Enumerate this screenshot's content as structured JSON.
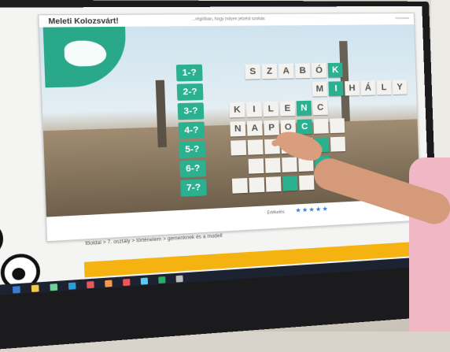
{
  "card": {
    "title": "Meleti Kolozsvárt!",
    "subtitle": "...régióban, hogy milyen jelzést szokás",
    "corner": "Mondatok"
  },
  "puzzle": {
    "numbers": [
      "1-?",
      "2-?",
      "3-?",
      "4-?",
      "5-?",
      "6-?",
      "7-?"
    ],
    "rows": [
      {
        "letters": [
          "S",
          "Z",
          "A",
          "B",
          "Ó",
          "K"
        ],
        "keyIndex": 5,
        "offset": 2
      },
      {
        "letters": [
          "M",
          "I",
          "H",
          "Á",
          "L",
          "Y"
        ],
        "keyIndex": 1,
        "offset": 6
      },
      {
        "letters": [
          "K",
          "I",
          "L",
          "E",
          "N",
          "C"
        ],
        "keyIndex": 4,
        "offset": 1
      },
      {
        "letters": [
          "N",
          "A",
          "P",
          "O",
          "C",
          "",
          ""
        ],
        "keyIndex": 4,
        "offset": 1
      },
      {
        "letters": [
          "",
          "",
          "",
          "",
          "",
          "",
          ""
        ],
        "keyIndex": 5,
        "offset": 1
      },
      {
        "letters": [
          "",
          "",
          "",
          "",
          ""
        ],
        "keyIndex": 4,
        "offset": 2
      },
      {
        "letters": [
          "",
          "",
          "",
          "",
          ""
        ],
        "keyIndex": 3,
        "offset": 1
      }
    ]
  },
  "footer": {
    "rating_label": "Értékelés",
    "stars": "★★★★★",
    "breadcrumb": "főoldal > 7. osztály > történelem > gemenknek és a modell"
  },
  "colors": {
    "accent": "#2bb090",
    "orange": "#f5b312",
    "taskbar": "#1c2230"
  }
}
